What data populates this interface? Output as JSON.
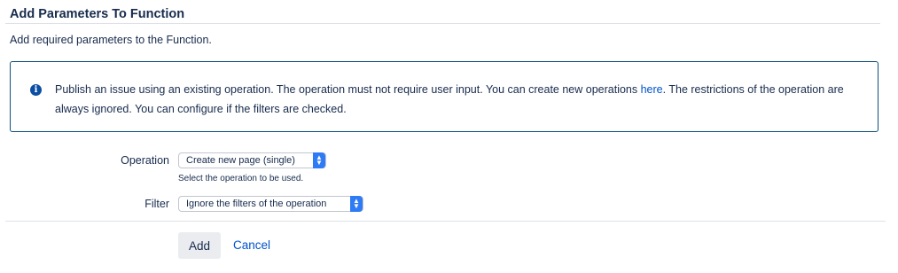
{
  "dialog": {
    "title": "Add Parameters To Function",
    "subtitle": "Add required parameters to the Function."
  },
  "info": {
    "icon": "info-icon",
    "text_before_link": "Publish an issue using an existing operation. The operation must not require user input. You can create new operations ",
    "link_text": "here",
    "text_after_link": ". The restrictions of the operation are always ignored. You can configure if the filters are checked."
  },
  "form": {
    "operation": {
      "label": "Operation",
      "value": "Create new page (single)",
      "help": "Select the operation to be used."
    },
    "filter": {
      "label": "Filter",
      "value": "Ignore the filters of the operation"
    }
  },
  "actions": {
    "add_label": "Add",
    "cancel_label": "Cancel"
  },
  "colors": {
    "link": "#0052cc",
    "info_border": "#0b4f7a",
    "info_icon": "#0c4ea2",
    "select_chevron": "#2f7bf5"
  }
}
